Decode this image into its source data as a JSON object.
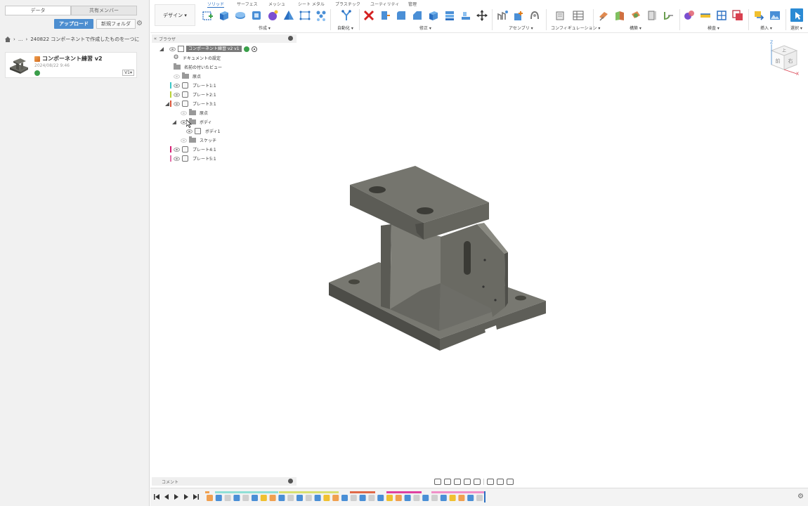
{
  "left_panel": {
    "tabs": [
      "データ",
      "共有メンバー"
    ],
    "upload_label": "アップロード",
    "new_folder_label": "新規フォルダ",
    "breadcrumb_ellipsis": "...",
    "breadcrumb_path": "240822 コンポーネントで作成したものを一つに",
    "file_card": {
      "title": "コンポーネント練習 v2",
      "date": "2024/08/22 9:46",
      "version": "V1▾"
    }
  },
  "toolbar": {
    "workspace_label": "デザイン ▾",
    "tabs": [
      "ソリッド",
      "サーフェス",
      "メッシュ",
      "シート メタル",
      "プラスチック",
      "ユーティリティ",
      "管理"
    ],
    "active_tab": "ソリッド",
    "groups": [
      "作成 ▾",
      "自動化 ▾",
      "修正 ▾",
      "アセンブリ ▾",
      "コンフィギュレーション ▾",
      "構築 ▾",
      "検査 ▾",
      "挿入 ▾",
      "選択 ▾"
    ],
    "colors": {
      "accent": "#2a6fc2",
      "select": "#2a8ad4"
    }
  },
  "browser": {
    "title": "ブラウザ",
    "root": "コンポーネント練習 v2 v1",
    "items": [
      {
        "label": "ドキュメントの設定",
        "icon": "gear-icon"
      },
      {
        "label": "名前の付いたビュー",
        "icon": "folder-icon"
      },
      {
        "label": "原点",
        "icon": "folder-icon"
      },
      {
        "label": "プレート1:1",
        "icon": "component-icon",
        "color": "#3bc6c6"
      },
      {
        "label": "プレート2:1",
        "icon": "component-icon",
        "color": "#b9d235"
      },
      {
        "label": "プレート3:1",
        "icon": "component-icon",
        "color": "#d9553a"
      },
      {
        "label": "原点",
        "icon": "folder-icon"
      },
      {
        "label": "ボディ",
        "icon": "folder-icon"
      },
      {
        "label": "ボディ1",
        "icon": "body-icon"
      },
      {
        "label": "スケッチ",
        "icon": "folder-icon"
      },
      {
        "label": "プレート4:1",
        "icon": "component-icon",
        "color": "#d61f73"
      },
      {
        "label": "プレート5:1",
        "icon": "component-icon",
        "color": "#e36fa8"
      }
    ]
  },
  "viewcube": {
    "top": "上",
    "front": "前",
    "right": "右",
    "axis_x": "X",
    "axis_z": "Z"
  },
  "comment_bar": {
    "label": "コメント"
  }
}
